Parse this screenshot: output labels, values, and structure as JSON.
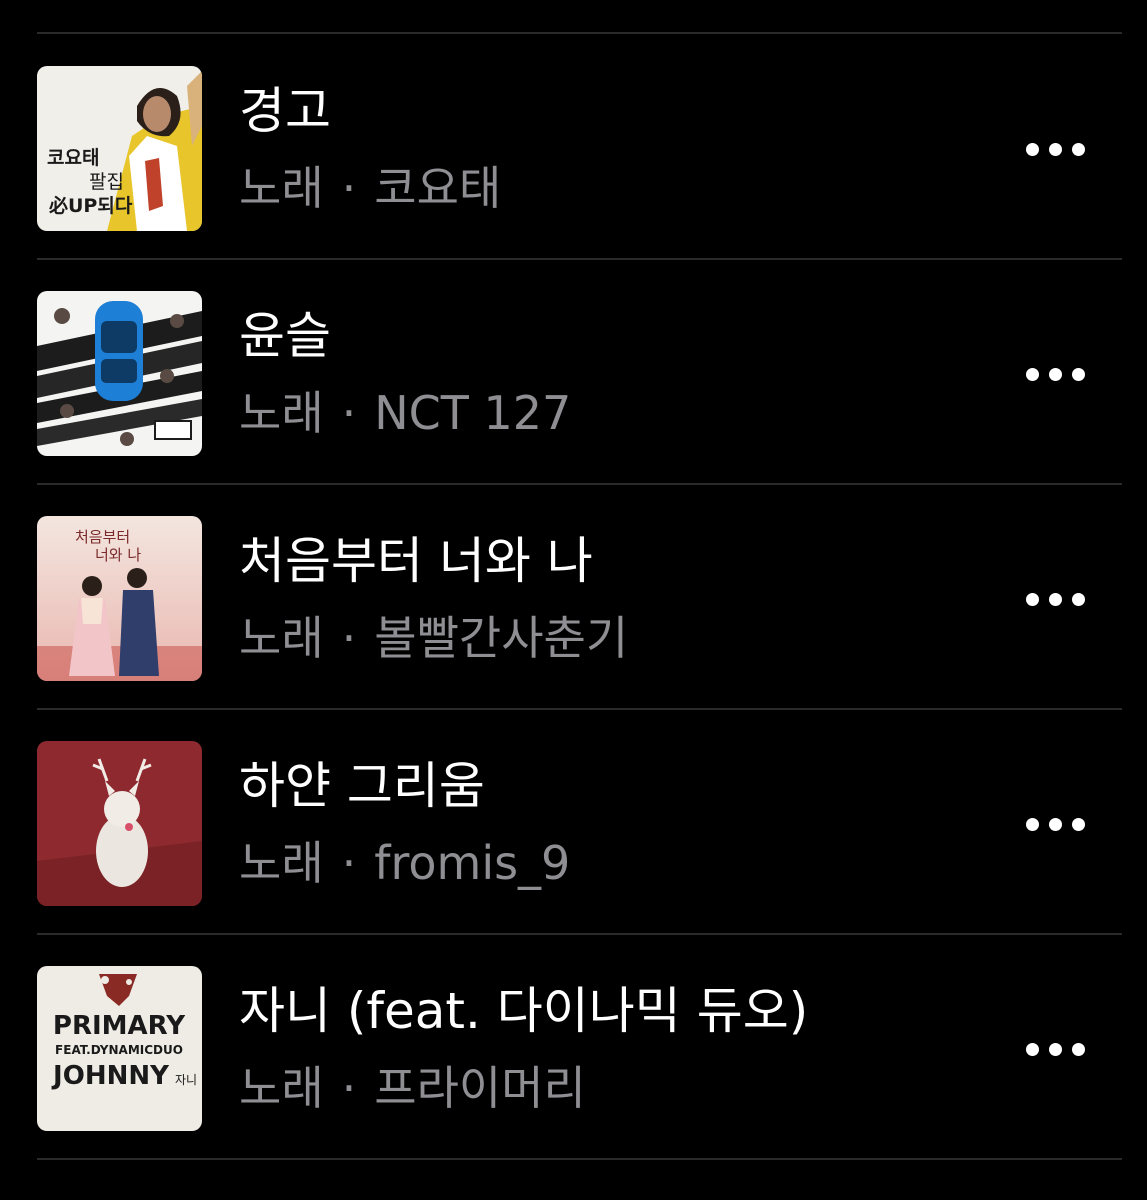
{
  "songs": [
    {
      "title": "경고",
      "type": "노래",
      "separator": "·",
      "artist": "코요태",
      "art_lines": [
        "코요태",
        "팔집",
        "必UP되다"
      ]
    },
    {
      "title": "윤슬",
      "type": "노래",
      "separator": "·",
      "artist": "NCT 127"
    },
    {
      "title": "처음부터 너와 나",
      "type": "노래",
      "separator": "·",
      "artist": "볼빨간사춘기",
      "art_lines": [
        "처음부터",
        "너와 나"
      ]
    },
    {
      "title": "하얀 그리움",
      "type": "노래",
      "separator": "·",
      "artist": "fromis_9"
    },
    {
      "title": "자니 (feat. 다이나믹 듀오)",
      "type": "노래",
      "separator": "·",
      "artist": "프라이머리",
      "art_lines": [
        "PRIMARY",
        "FEAT.DYNAMICDUO",
        "JOHNNY",
        "자니"
      ]
    }
  ],
  "more_icon": "ellipsis-icon",
  "colors": {
    "background": "#000000",
    "title": "#ffffff",
    "subtitle": "#8e8e93",
    "divider": "#2a2a2c"
  }
}
